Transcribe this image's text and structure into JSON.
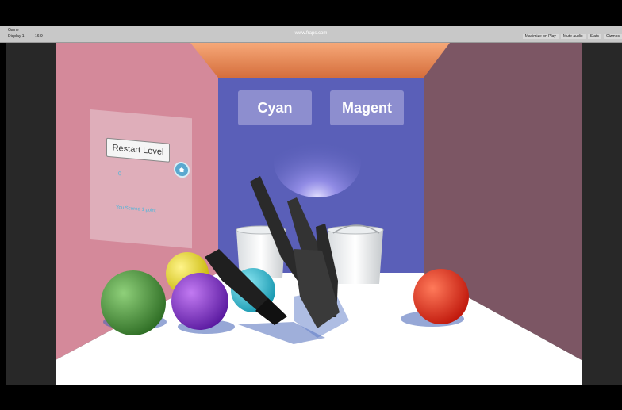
{
  "editor": {
    "tab_title": "Game",
    "display_label": "Display 1",
    "aspect_label": "16:9",
    "watermark": "www.fraps.com",
    "buttons": [
      "Maximize on Play",
      "Mute audio",
      "Stats",
      "Gizmos"
    ]
  },
  "game": {
    "color_buttons": {
      "cyan": "Cyan",
      "magent": "Magent"
    },
    "restart_label": "Restart Level",
    "score_value": "0",
    "score_text": "You Scored 1 point"
  },
  "colors": {
    "left_wall": "#d4899a",
    "right_wall": "#7c5664",
    "back_wall": "#5a5fb8",
    "ceiling": "#e99063",
    "floor": "#ffffff"
  },
  "scene_objects": [
    "green-ball",
    "yellow-ball",
    "purple-ball",
    "cyan-ball",
    "red-ball",
    "white-bucket",
    "white-bucket",
    "hand-model"
  ]
}
